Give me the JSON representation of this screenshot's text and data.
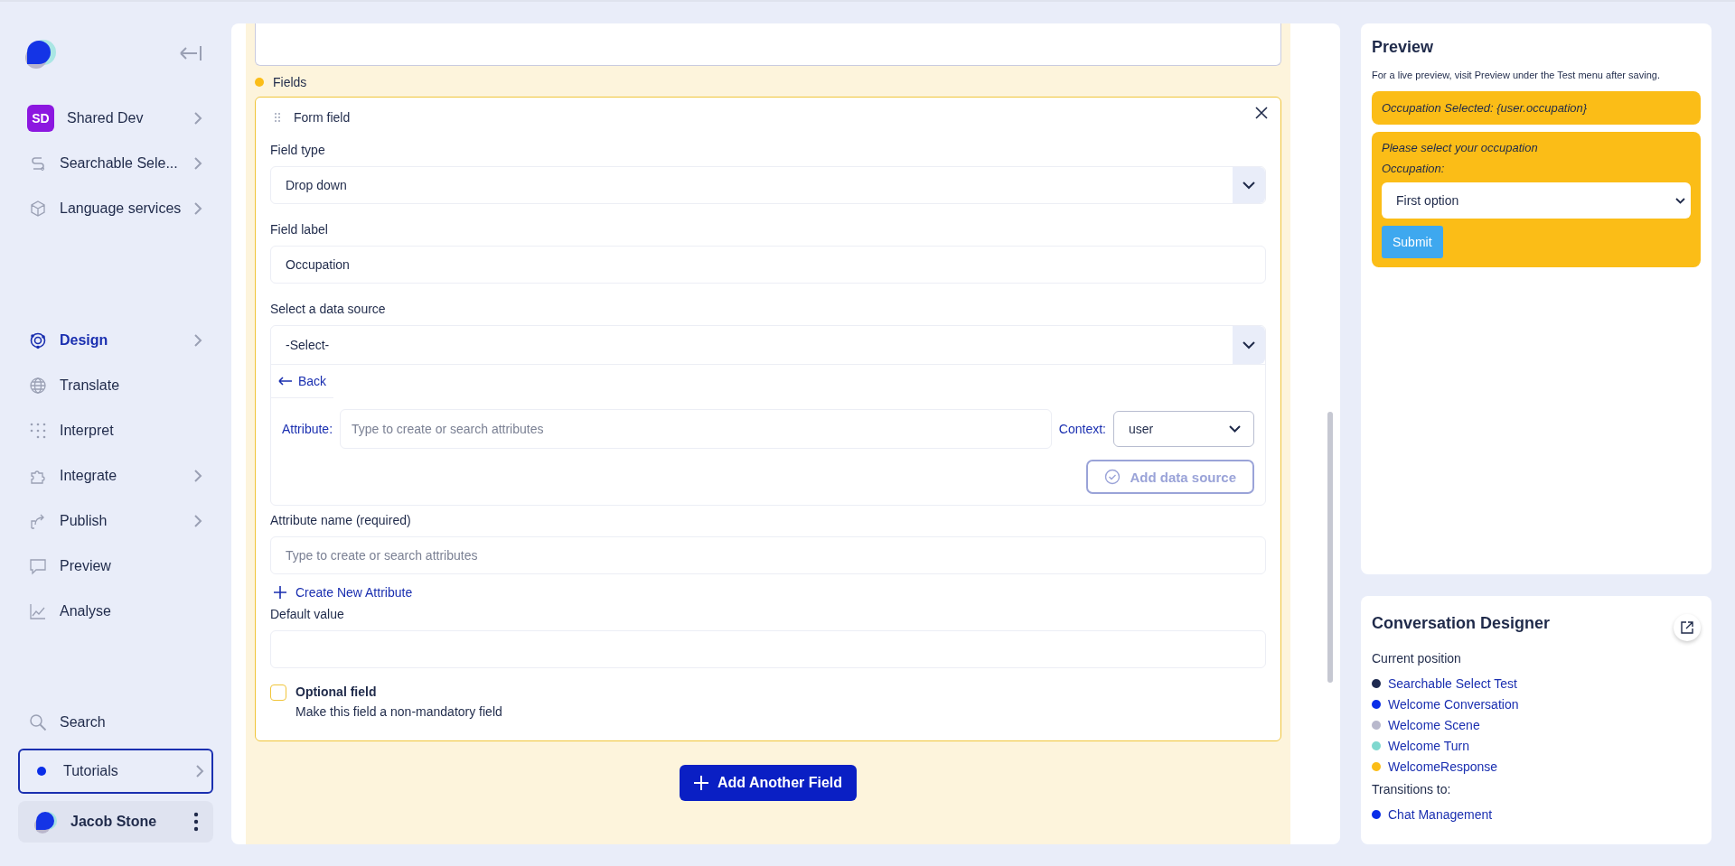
{
  "sidebar": {
    "workspace_items": [
      {
        "label": "Shared Dev",
        "kind": "initials",
        "initials": "SD",
        "has_submenu": true
      },
      {
        "label": "Searchable Sele...",
        "kind": "route",
        "has_submenu": true
      },
      {
        "label": "Language services",
        "kind": "cube",
        "has_submenu": true
      }
    ],
    "nav_items": [
      {
        "label": "Design",
        "kind": "design",
        "selected": true,
        "has_submenu": true
      },
      {
        "label": "Translate",
        "kind": "globe",
        "selected": false,
        "has_submenu": false
      },
      {
        "label": "Interpret",
        "kind": "dots",
        "selected": false,
        "has_submenu": false
      },
      {
        "label": "Integrate",
        "kind": "puzzle",
        "selected": false,
        "has_submenu": true
      },
      {
        "label": "Publish",
        "kind": "share",
        "selected": false,
        "has_submenu": true
      },
      {
        "label": "Preview",
        "kind": "chat",
        "selected": false,
        "has_submenu": false
      },
      {
        "label": "Analyse",
        "kind": "chart",
        "selected": false,
        "has_submenu": false
      }
    ],
    "search": {
      "label": "Search"
    },
    "tutorials": {
      "label": "Tutorials",
      "has_submenu": true
    },
    "user": {
      "name": "Jacob Stone"
    }
  },
  "form": {
    "section_label": "Fields",
    "field_card": {
      "title": "Form field",
      "field_type": {
        "label": "Field type",
        "value": "Drop down"
      },
      "field_label": {
        "label": "Field label",
        "value": "Occupation"
      },
      "data_source": {
        "label": "Select a data source",
        "value": "-Select-",
        "back": "Back",
        "attribute_label": "Attribute:",
        "attribute_placeholder": "Type to create or search attributes",
        "context_label": "Context:",
        "context_value": "user",
        "add_button": "Add data source"
      },
      "attribute_name": {
        "label": "Attribute name (required)",
        "placeholder": "Type to create or search attributes",
        "create_link": "Create New Attribute"
      },
      "default_value": {
        "label": "Default value"
      },
      "optional": {
        "label": "Optional field",
        "description": "Make this field a non-mandatory field",
        "checked": false
      }
    },
    "add_button": "Add Another Field"
  },
  "preview": {
    "title": "Preview",
    "hint": "For a live preview, visit Preview under the Test menu after saving.",
    "message": "Occupation Selected: {user.occupation}",
    "prompt": "Please select your occupation",
    "select_label": "Occupation:",
    "select_value": "First option",
    "submit": "Submit"
  },
  "designer": {
    "title": "Conversation Designer",
    "current_label": "Current position",
    "current": [
      {
        "label": "Searchable Select Test",
        "color": "#1e2a50"
      },
      {
        "label": "Welcome Conversation",
        "color": "#0a2ee8"
      },
      {
        "label": "Welcome Scene",
        "color": "#b8b8cc"
      },
      {
        "label": "Welcome Turn",
        "color": "#7fd8cf"
      },
      {
        "label": "WelcomeResponse",
        "color": "#fbbd17"
      }
    ],
    "transitions_label": "Transitions to:",
    "transitions": [
      {
        "label": "Chat Management",
        "color": "#0a2ee8"
      }
    ]
  }
}
